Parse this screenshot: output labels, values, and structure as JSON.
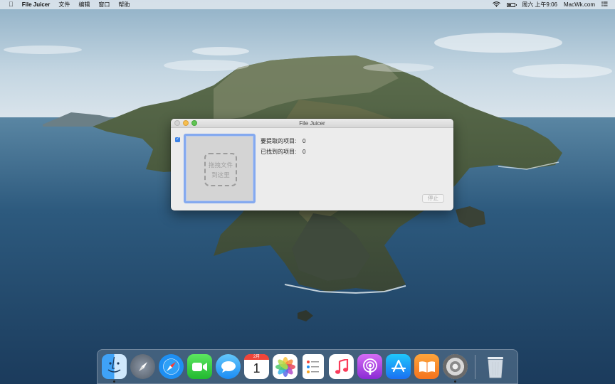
{
  "menubar": {
    "app_name": "File Juicer",
    "menus": [
      "文件",
      "编辑",
      "窗口",
      "帮助"
    ],
    "clock": "周六 上午9:06",
    "site": "MacWk.com"
  },
  "window": {
    "title": "File Juicer",
    "dropzone_line1": "拖拽文件",
    "dropzone_line2": "到这里",
    "stats": [
      {
        "label": "要提取的项目:",
        "value": "0"
      },
      {
        "label": "已找到的项目:",
        "value": "0"
      }
    ],
    "stop_label": "停止",
    "checkbox_checked": true
  },
  "dock": {
    "calendar_month": "2月",
    "calendar_day": "1",
    "icons": [
      "finder-icon",
      "launchpad-icon",
      "safari-icon",
      "facetime-icon",
      "messages-icon",
      "calendar-icon",
      "photos-icon",
      "reminders-icon",
      "music-icon",
      "podcasts-icon",
      "app-store-icon",
      "books-icon",
      "file-juicer-icon",
      "trash-icon"
    ]
  },
  "colors": {
    "accent": "#3b82e6",
    "dropzone_border": "#84a9ef"
  }
}
